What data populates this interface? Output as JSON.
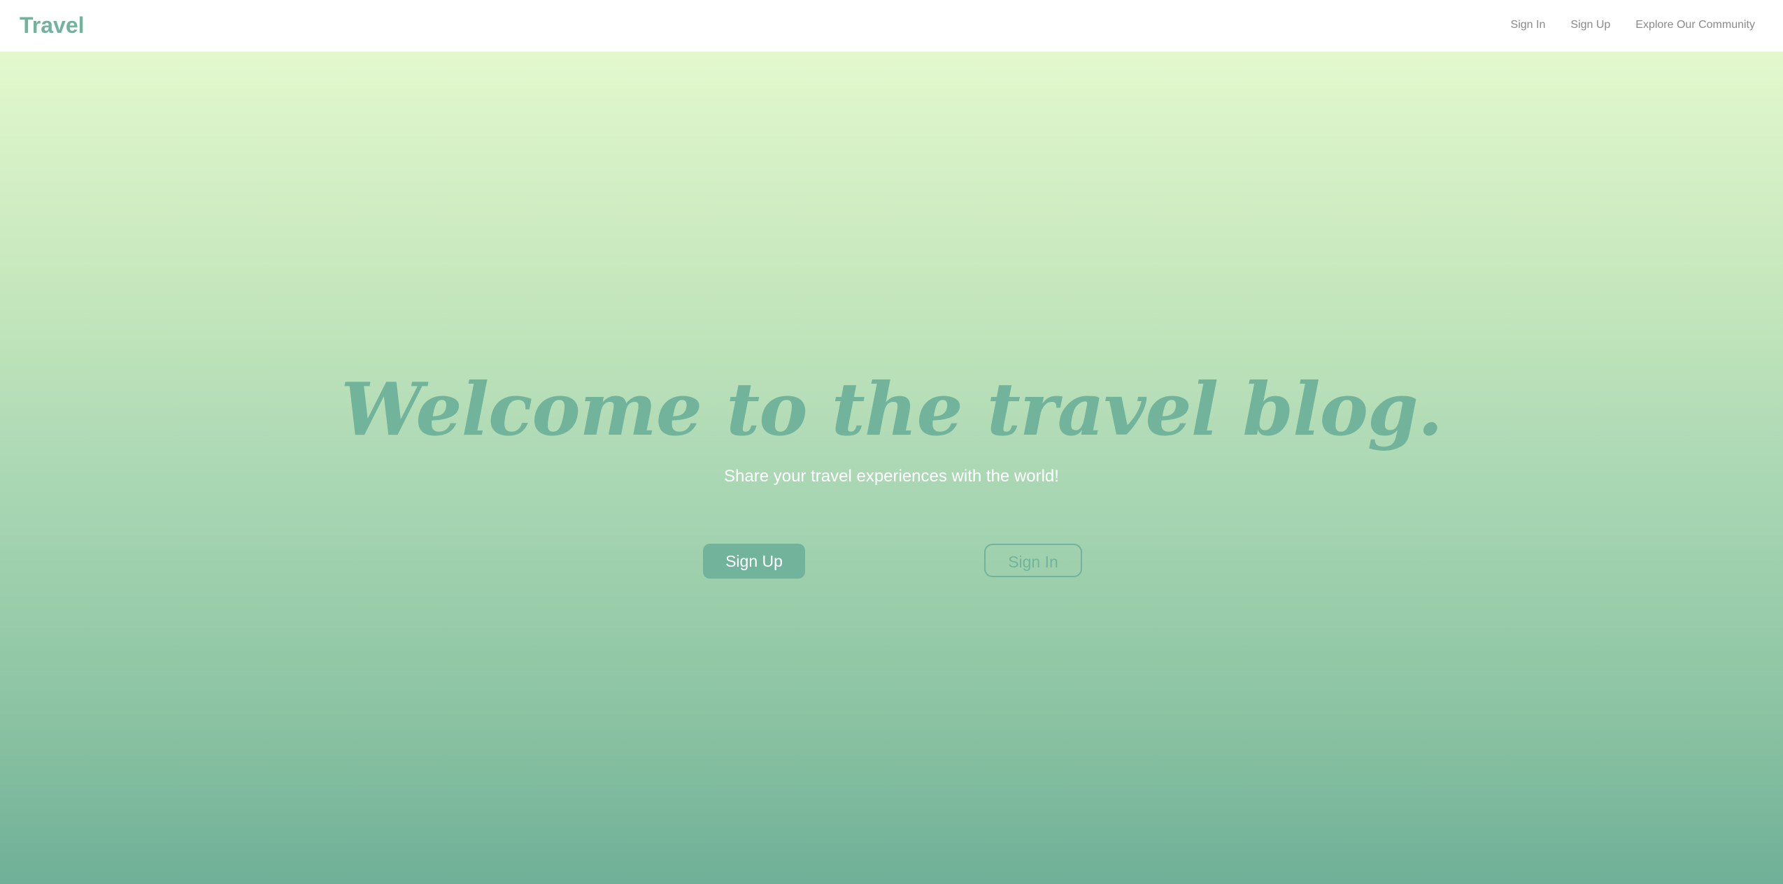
{
  "navbar": {
    "brand": "Travel",
    "links": [
      {
        "label": "Sign In"
      },
      {
        "label": "Sign Up"
      },
      {
        "label": "Explore Our Community"
      }
    ]
  },
  "hero": {
    "headline": "Welcome to the travel blog.",
    "subtitle": "Share your travel experiences with the world!",
    "primary_button": "Sign Up",
    "secondary_button": "Sign In"
  },
  "colors": {
    "accent": "#72b39b",
    "nav_link": "#8a8a8a",
    "gradient_top": "#e3f8cd",
    "gradient_bottom": "#6fb098"
  }
}
